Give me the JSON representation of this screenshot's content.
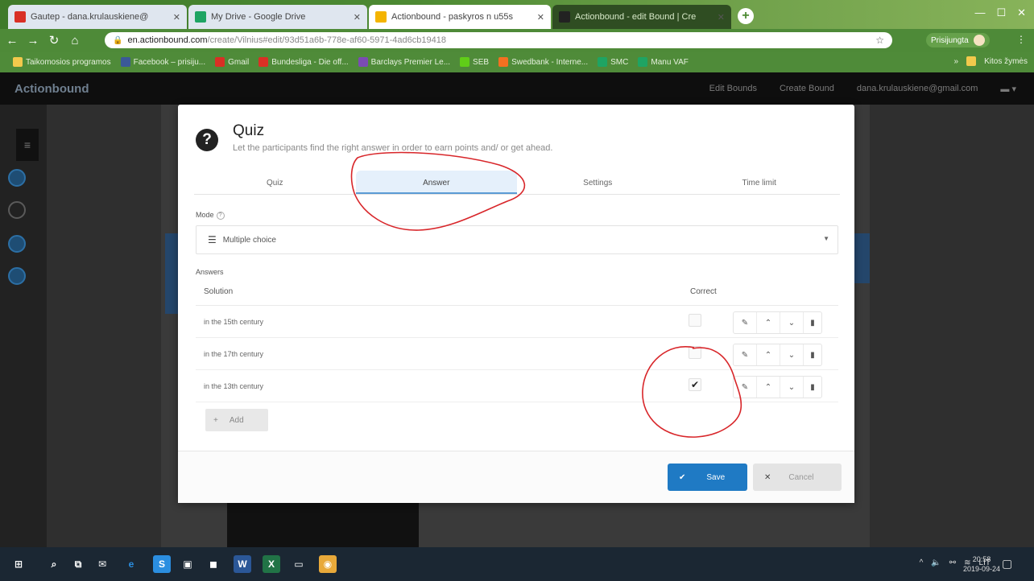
{
  "browser": {
    "tabs": [
      {
        "title": "Gautep - dana.krulauskiene@",
        "favicon_color": "#d93025"
      },
      {
        "title": "My Drive - Google Drive",
        "favicon_color": "#1fa463"
      },
      {
        "title": "Actionbound - paskyros n u55s",
        "favicon_color": "#f4b400"
      },
      {
        "title": "Actionbound - edit Bound | Cre",
        "favicon_color": "#222222"
      }
    ],
    "url_host": "en.actionbound.com",
    "url_path": "/create/Vilnius#edit/93d51a6b-778e-af60-5971-4ad6cb19418",
    "profile_label": "Prisijungta",
    "bookmarks": [
      {
        "label": "Taikomosios programos",
        "color": "#f2c94c"
      },
      {
        "label": "Facebook – prisiju...",
        "color": "#3b5998"
      },
      {
        "label": "Gmail",
        "color": "#d93025"
      },
      {
        "label": "Bundesliga - Die off...",
        "color": "#d93025"
      },
      {
        "label": "Barclays Premier Le...",
        "color": "#7b4bb3"
      },
      {
        "label": "SEB",
        "color": "#60cd18"
      },
      {
        "label": "Swedbank - Interne...",
        "color": "#f37021"
      },
      {
        "label": "SMC",
        "color": "#1fa463"
      },
      {
        "label": "Manu VAF",
        "color": "#1fa463"
      }
    ],
    "bookmarks_right": "Kitos žymės"
  },
  "app": {
    "logo": "Actionbound",
    "nav": [
      "Edit Bounds",
      "Create Bound",
      "dana.krulauskiene@gmail.com"
    ]
  },
  "modal": {
    "title": "Quiz",
    "subtitle": "Let the participants find the right answer in order to earn points and/ or get ahead.",
    "tabs": [
      "Quiz",
      "Answer",
      "Settings",
      "Time limit"
    ],
    "active_tab": "Answer",
    "mode_label": "Mode",
    "mode_value": "Multiple choice",
    "answers_label": "Answers",
    "col_solution": "Solution",
    "col_correct": "Correct",
    "answers": [
      {
        "text": "in the 15th century",
        "correct": false
      },
      {
        "text": "in the 17th century",
        "correct": false
      },
      {
        "text": "in the 13th century",
        "correct": true
      }
    ],
    "add_label": "Add",
    "save_label": "Save",
    "cancel_label": "Cancel"
  },
  "taskbar": {
    "tray_lang": "LIT",
    "time": "20:58",
    "date": "2019-09-24"
  },
  "colors": {
    "accent": "#1f7ac4",
    "annotation_red": "#d8262a"
  }
}
